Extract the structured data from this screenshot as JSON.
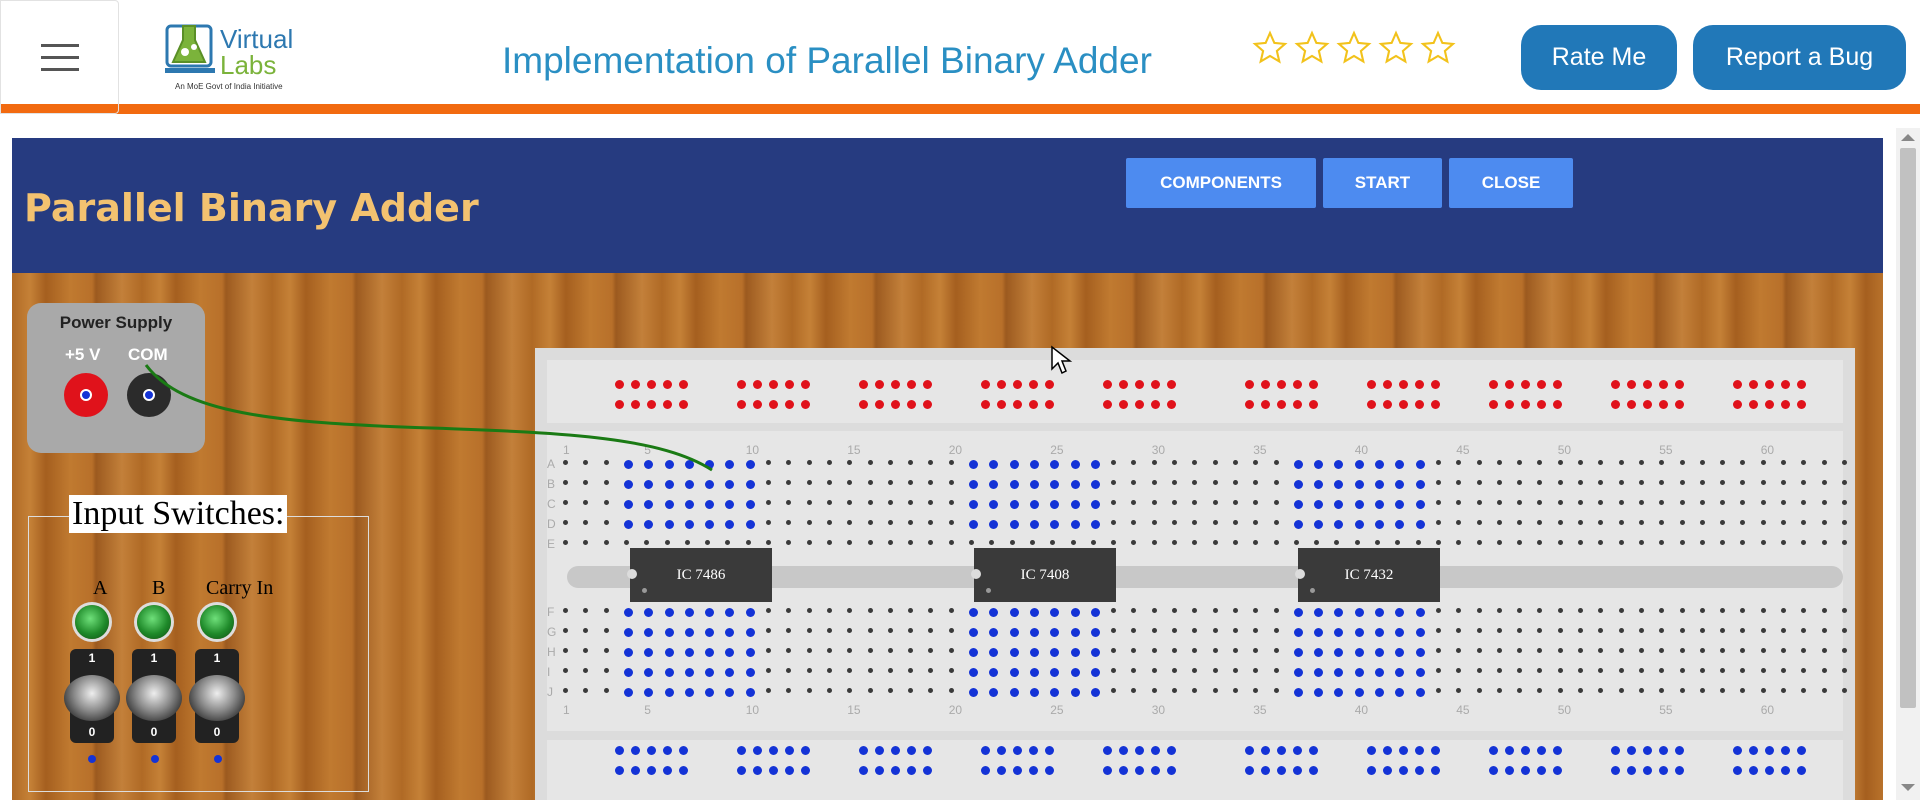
{
  "header": {
    "menu_icon": "hamburger-icon",
    "logo": {
      "line1": "Virtual",
      "line2": "Labs",
      "tagline": "An MoE Govt of India Initiative"
    },
    "title": "Implementation of Parallel Binary Adder",
    "rating": {
      "max_stars": 5,
      "filled": 0,
      "star_color": "#f2c21b"
    },
    "rate_button": "Rate Me",
    "bug_button": "Report a Bug",
    "accent_color": "#f26a10"
  },
  "simulator": {
    "title": "Parallel Binary Adder",
    "buttons": {
      "components": "COMPONENTS",
      "start": "START",
      "close": "CLOSE"
    },
    "power_supply": {
      "label": "Power Supply",
      "positive": "+5 V",
      "common": "COM"
    },
    "input_switches": {
      "title": "Input Switches:",
      "switches": [
        {
          "label": "A",
          "state": "0"
        },
        {
          "label": "B",
          "state": "0"
        },
        {
          "label": "Carry In",
          "state": "0"
        }
      ],
      "on_label": "1",
      "off_label": "0"
    },
    "breadboard": {
      "ics": [
        "IC 7486",
        "IC 7408",
        "IC 7432"
      ],
      "column_numbers": [
        "1",
        "5",
        "10",
        "15",
        "20",
        "25",
        "30",
        "35",
        "40",
        "45",
        "50",
        "55",
        "60"
      ],
      "row_letters_top": [
        "A",
        "B",
        "C",
        "D",
        "E"
      ],
      "row_letters_bottom": [
        "F",
        "G",
        "H",
        "I",
        "J"
      ]
    }
  }
}
